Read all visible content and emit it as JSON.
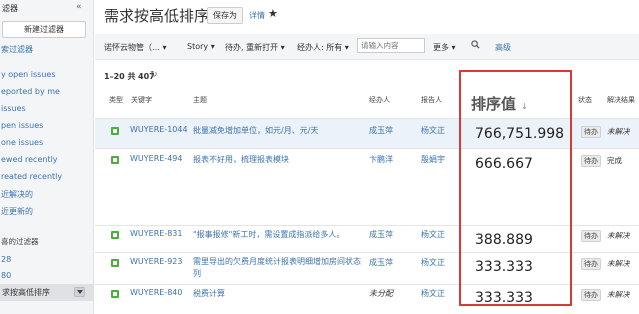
{
  "sidebar": {
    "title": "滤器",
    "collapse": "«",
    "new_filter": "新建过滤器",
    "search_filters": "索过滤器",
    "items": [
      "y open issues",
      "eported by me",
      " issues",
      "pen issues",
      "one issues",
      "ewed recently",
      "reated recently",
      "近解决的",
      "近更新的"
    ],
    "favorites_section": "喜的过滤器",
    "favorites": [
      "28",
      "80"
    ],
    "active_filter": "求按高低排序"
  },
  "header": {
    "title": "需求按高低排序",
    "save_as": "保存为",
    "details": "详情",
    "star": "★"
  },
  "filter_bar": {
    "project": "诺怀云物管（…",
    "project_caret": "▾",
    "story": "Story",
    "story_caret": "▾",
    "status": "待办, 重新打开",
    "status_caret": "▾",
    "assignee": "经办人: 所有",
    "assignee_caret": "▾",
    "search_placeholder": "请输入内容",
    "more": "更多",
    "more_caret": "▾",
    "advanced": "高级"
  },
  "results": {
    "range": "1–20 共",
    "total": "407",
    "refresh": "↻"
  },
  "columns": {
    "type": "类型",
    "key": "关键字",
    "summary": "主题",
    "assignee": "经办人",
    "reporter": "报告人",
    "rank": "排序值",
    "rank_arrow": "↓",
    "status": "状态",
    "resolution": "解决结果"
  },
  "rows": [
    {
      "key": "WUYERE-1044",
      "summary": "批量减免增加单位，如元/月、元/天",
      "assignee": "成玉萍",
      "reporter": "杨文正",
      "rank": "766,751.998",
      "status": "待办",
      "resolution": "未解决"
    },
    {
      "key": "WUYERE-494",
      "summary": "报表不好用，梳理报表模块",
      "assignee": "卞鹏洋",
      "reporter": "殷娟宇",
      "rank": "666.667",
      "status": "待办",
      "resolution": "完成"
    },
    {
      "key": "WUYERE-831",
      "summary": "\"报事报修\"新工时，需设置成指派给多人。",
      "assignee": "成玉萍",
      "reporter": "杨文正",
      "rank": "388.889",
      "status": "待办",
      "resolution": "未解决"
    },
    {
      "key": "WUYERE-923",
      "summary": "需里导出的欠费月度统计报表明细增加房间状态列",
      "assignee": "成玉萍",
      "reporter": "杨文正",
      "rank": "333.333",
      "status": "待办",
      "resolution": "未解决"
    },
    {
      "key": "WUYERE-840",
      "summary": "税费计算",
      "assignee": "未分配",
      "reporter": "杨文正",
      "rank": "333.333",
      "status": "待办",
      "resolution": "未解决"
    }
  ],
  "colors": {
    "link": "#3b73af",
    "highlight_box": "#d93a35",
    "story_icon": "#4fad3e",
    "selected_row": "#ebf2f9"
  }
}
